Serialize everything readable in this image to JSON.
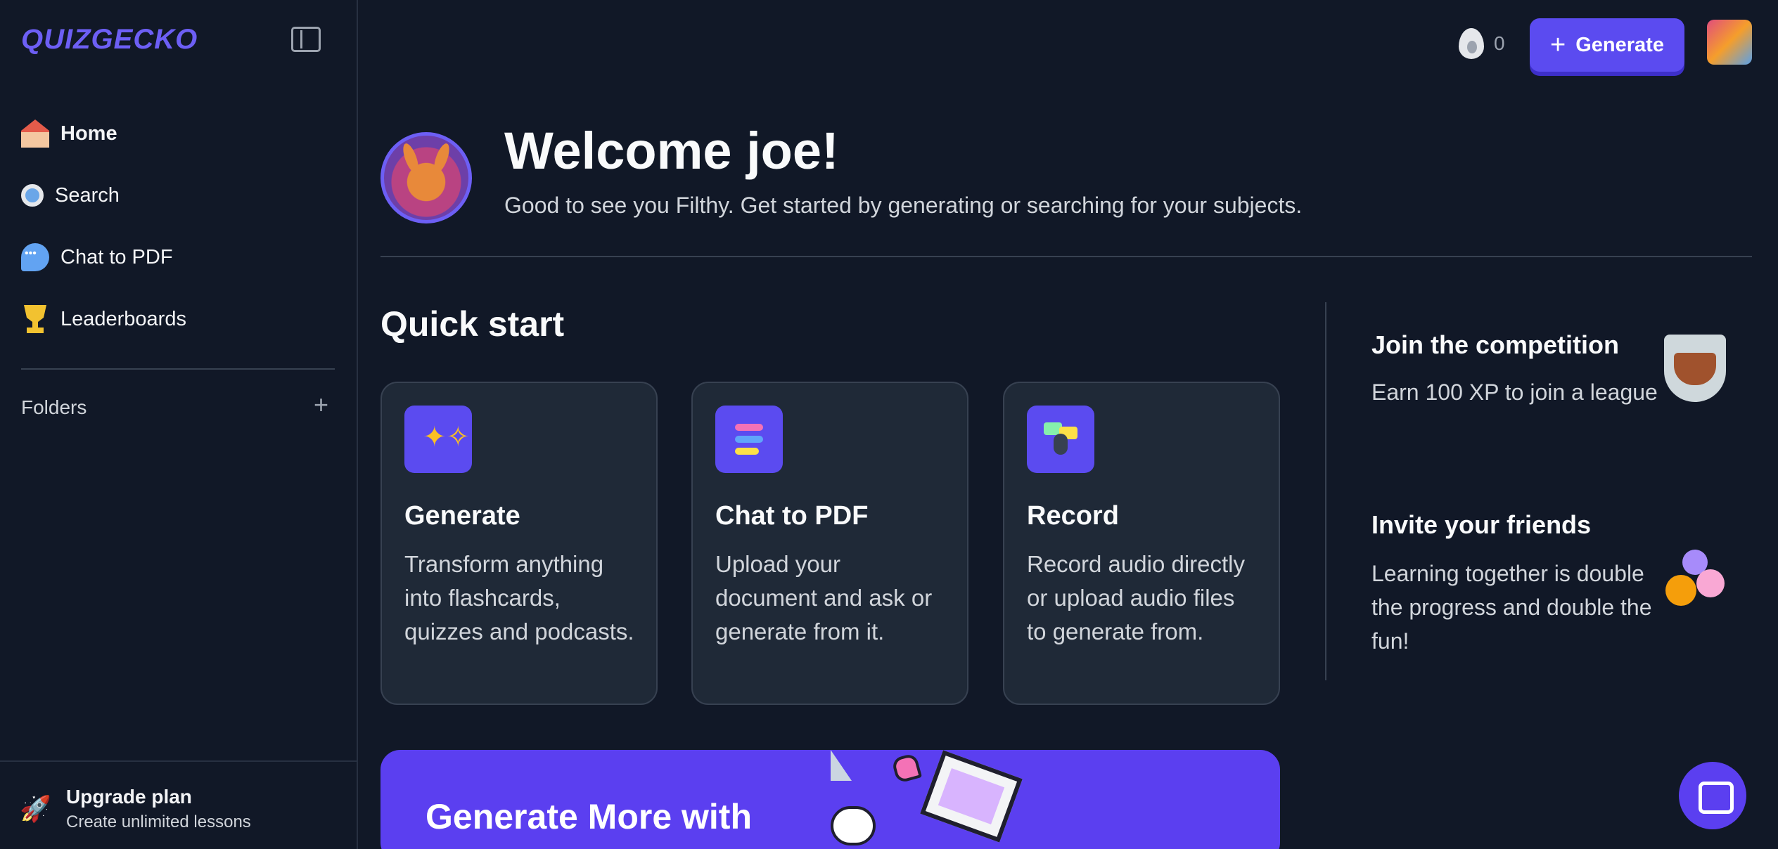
{
  "app": {
    "logo": "QUIZGECKO"
  },
  "sidebar": {
    "items": [
      {
        "label": "Home",
        "icon": "home-icon",
        "active": true
      },
      {
        "label": "Search",
        "icon": "magnifier-icon"
      },
      {
        "label": "Chat to PDF",
        "icon": "speech-bubble-icon"
      },
      {
        "label": "Leaderboards",
        "icon": "trophy-icon"
      }
    ],
    "folders_label": "Folders",
    "folders_add": "+",
    "upgrade": {
      "title": "Upgrade plan",
      "subtitle": "Create unlimited lessons"
    }
  },
  "topbar": {
    "streak_count": "0",
    "generate_label": "Generate",
    "generate_plus": "+"
  },
  "welcome": {
    "title": "Welcome joe!",
    "subtitle": "Good to see you Filthy. Get started by generating or searching for your subjects."
  },
  "quick_start": {
    "title": "Quick start",
    "cards": [
      {
        "title": "Generate",
        "description": "Transform anything into flashcards, quizzes and podcasts.",
        "icon": "sparkles-icon"
      },
      {
        "title": "Chat to PDF",
        "description": "Upload your document and ask or generate from it.",
        "icon": "chat-bars-icon"
      },
      {
        "title": "Record",
        "description": "Record audio directly or upload audio files to generate from.",
        "icon": "microphone-icon"
      }
    ]
  },
  "side_panels": {
    "competition": {
      "title": "Join the competition",
      "description": "Earn 100 XP to join a league",
      "icon": "league-shield-icon"
    },
    "invite": {
      "title": "Invite your friends",
      "description": "Learning together is double the progress and double the fun!",
      "icon": "friends-icon"
    }
  },
  "banner": {
    "title": "Generate More with"
  },
  "colors": {
    "background": "#111827",
    "card": "#1f2937",
    "accent": "#5b4bf0",
    "logo": "#6d5ff5"
  }
}
